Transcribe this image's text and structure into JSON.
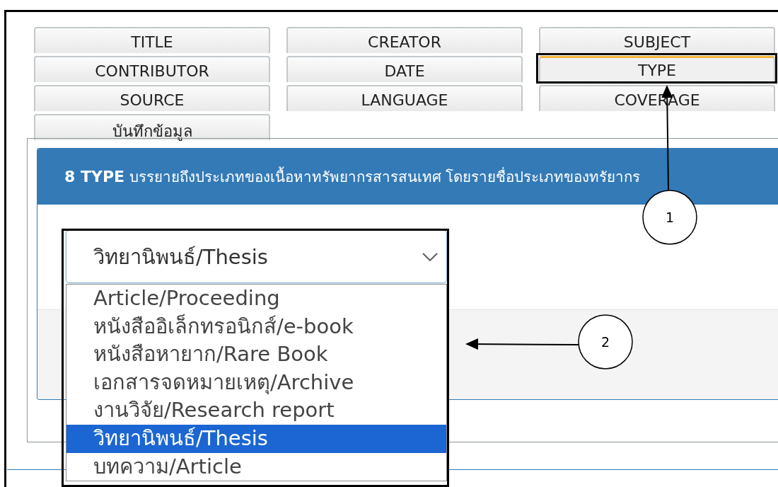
{
  "tabs": [
    {
      "label": "TITLE",
      "selected": false
    },
    {
      "label": "CREATOR",
      "selected": false
    },
    {
      "label": "SUBJECT",
      "selected": false
    },
    {
      "label": "CONTRIBUTOR",
      "selected": false
    },
    {
      "label": "DATE",
      "selected": false
    },
    {
      "label": "TYPE",
      "selected": true
    },
    {
      "label": "SOURCE",
      "selected": false
    },
    {
      "label": "LANGUAGE",
      "selected": false
    },
    {
      "label": "COVERAGE",
      "selected": false
    },
    {
      "label": "บันทึกข้อมูล",
      "selected": false
    }
  ],
  "panel": {
    "heading": "**8 TYPE** บรรยายถึงประเภทของเนื้อหาทรัพยากรสารสนเทศ โดยรายชื่อประเภทของทรัยากร",
    "select": {
      "value": "วิทยานิพนธ์/Thesis",
      "expanded": true,
      "options": [
        {
          "label": "Article/Proceeding",
          "selected": false
        },
        {
          "label": "หนังสืออิเล็กทรอนิกส์/e-book",
          "selected": false
        },
        {
          "label": "หนังสือหายาก/Rare Book",
          "selected": false
        },
        {
          "label": "เอกสารจดหมายเหตุ/Archive",
          "selected": false
        },
        {
          "label": "งานวิจัย/Research report",
          "selected": false
        },
        {
          "label": "วิทยานิพนธ์/Thesis",
          "selected": true
        },
        {
          "label": "บทความ/Article",
          "selected": false
        }
      ]
    }
  },
  "annotations": [
    {
      "label": "1"
    },
    {
      "label": "2"
    }
  ]
}
